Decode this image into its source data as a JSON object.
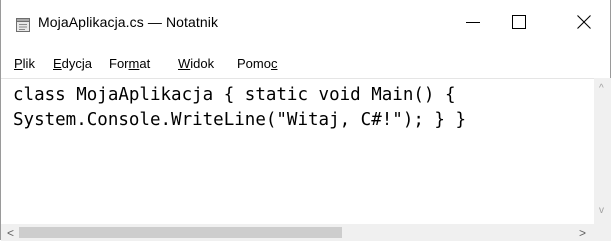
{
  "window": {
    "title": "MojaAplikacja.cs — Notatnik",
    "app_icon": "notepad-icon",
    "controls": {
      "minimize_icon": "minimize-icon",
      "maximize_icon": "maximize-icon",
      "close_icon": "close-icon"
    }
  },
  "menubar": {
    "items": [
      {
        "pre": "",
        "key": "P",
        "post": "lik"
      },
      {
        "pre": "",
        "key": "E",
        "post": "dycja"
      },
      {
        "pre": "For",
        "key": "m",
        "post": "at"
      },
      {
        "pre": "",
        "key": "W",
        "post": "idok"
      },
      {
        "pre": "Pomo",
        "key": "c",
        "post": ""
      }
    ]
  },
  "editor": {
    "lines": [
      "class MojaAplikacja { static void Main() {",
      "System.Console.WriteLine(\"Witaj, C#!\"); } }"
    ]
  },
  "scrollbars": {
    "horizontal_thumb_fraction": 0.58,
    "up_arrow": "^",
    "down_arrow": "v",
    "left_arrow": "<",
    "right_arrow": ">"
  }
}
